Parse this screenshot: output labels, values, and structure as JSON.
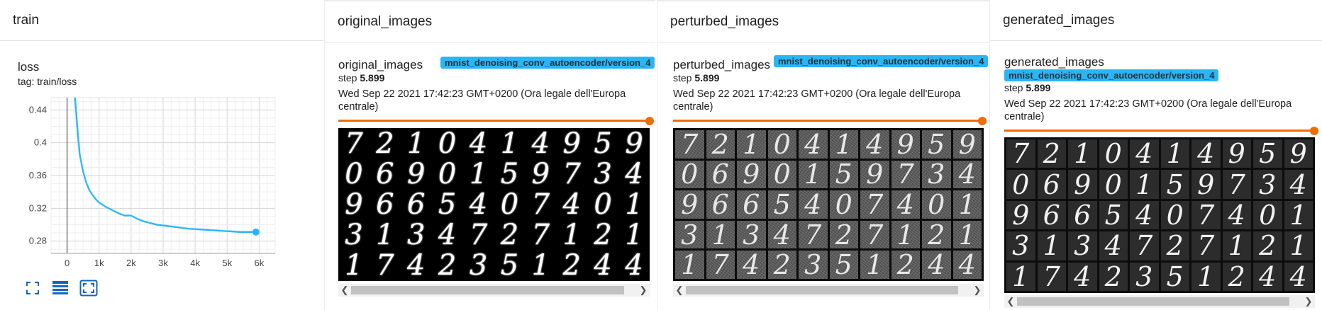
{
  "train": {
    "header": "train",
    "card_title": "loss",
    "card_tag": "tag: train/loss"
  },
  "chart_data": {
    "type": "line",
    "title": "loss",
    "subtitle": "tag: train/loss",
    "xlabel": "",
    "ylabel": "",
    "xlim": [
      -500,
      6500
    ],
    "ylim": [
      0.265,
      0.455
    ],
    "x_ticks": [
      "0",
      "1k",
      "2k",
      "3k",
      "4k",
      "5k",
      "6k"
    ],
    "y_ticks": [
      "0.44",
      "0.4",
      "0.36",
      "0.32",
      "0.28"
    ],
    "grid": true,
    "series": [
      {
        "color": "#29b6f6",
        "smoothed": true,
        "x": [
          250,
          300,
          350,
          400,
          500,
          600,
          700,
          800,
          900,
          1000,
          1200,
          1400,
          1600,
          1800,
          2000,
          2200,
          2400,
          2600,
          2800,
          3000,
          3400,
          3800,
          4200,
          4600,
          5000,
          5400,
          5899
        ],
        "y": [
          0.455,
          0.43,
          0.405,
          0.385,
          0.365,
          0.351,
          0.342,
          0.336,
          0.331,
          0.327,
          0.322,
          0.318,
          0.314,
          0.311,
          0.311,
          0.307,
          0.304,
          0.302,
          0.3,
          0.299,
          0.297,
          0.295,
          0.294,
          0.293,
          0.292,
          0.291,
          0.291
        ]
      }
    ],
    "raw_series_color": "#b3e5fc"
  },
  "toolbar": {
    "icon_color": "#1565c0"
  },
  "panels": {
    "original": {
      "header": "original_images",
      "title": "original_images",
      "run": "mnist_denoising_conv_autoencoder/version_4",
      "step_label": "step",
      "step_value": "5.899",
      "date": "Wed Sep 22 2021 17:42:23 GMT+0200 (Ora legale dell'Europa centrale)",
      "slider_value": 1.0
    },
    "perturbed": {
      "header": "perturbed_images",
      "title": "perturbed_images",
      "run": "mnist_denoising_conv_autoencoder/version_4",
      "step_label": "step",
      "step_value": "5.899",
      "date": "Wed Sep 22 2021 17:42:23 GMT+0200 (Ora legale dell'Europa centrale)",
      "slider_value": 1.0
    },
    "generated": {
      "header": "generated_images",
      "title": "generated_images",
      "run": "mnist_denoising_conv_autoencoder/version_4",
      "step_label": "step",
      "step_value": "5.899",
      "date": "Wed Sep 22 2021 17:42:23 GMT+0200 (Ora legale dell'Europa centrale)",
      "slider_value": 1.0
    }
  },
  "digits": [
    [
      "7",
      "2",
      "1",
      "0",
      "4",
      "1",
      "4",
      "9",
      "5",
      "9"
    ],
    [
      "0",
      "6",
      "9",
      "0",
      "1",
      "5",
      "9",
      "7",
      "3",
      "4"
    ],
    [
      "9",
      "6",
      "6",
      "5",
      "4",
      "0",
      "7",
      "4",
      "0",
      "1"
    ],
    [
      "3",
      "1",
      "3",
      "4",
      "7",
      "2",
      "7",
      "1",
      "2",
      "1"
    ],
    [
      "1",
      "7",
      "4",
      "2",
      "3",
      "5",
      "1",
      "2",
      "4",
      "4"
    ]
  ],
  "accent_color": "#ef6c00",
  "badge_color": "#29b6f6"
}
